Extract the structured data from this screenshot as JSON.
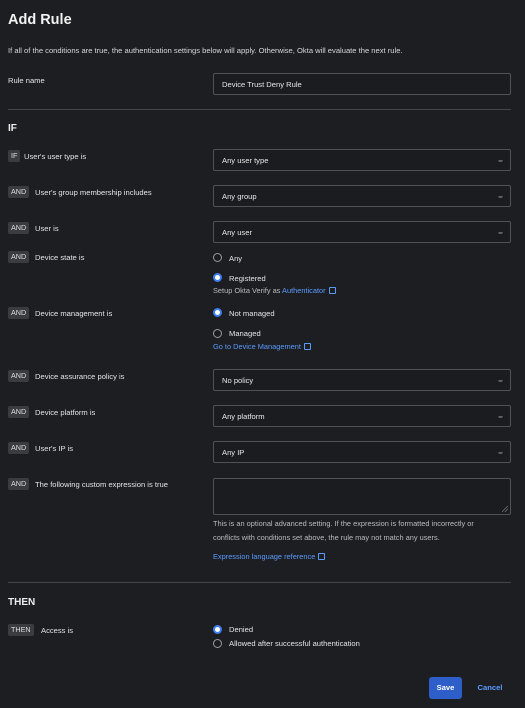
{
  "header": {
    "title": "Add Rule",
    "description": "If all of the conditions are true, the authentication settings below will apply. Otherwise, Okta will evaluate the next rule."
  },
  "rule_name": {
    "label": "Rule name",
    "value": "Device Trust Deny Rule"
  },
  "if_section": {
    "heading": "IF"
  },
  "conditions": {
    "user_type": {
      "tag": "IF",
      "label": "User's user type is",
      "value": "Any user type"
    },
    "group": {
      "tag": "AND",
      "label": "User's group membership includes",
      "value": "Any group"
    },
    "user": {
      "tag": "AND",
      "label": "User is",
      "value": "Any user"
    },
    "device_state": {
      "tag": "AND",
      "label": "Device state is",
      "options": [
        "Any",
        "Registered"
      ],
      "selected": "Registered",
      "helper_prefix": "Setup Okta Verify as",
      "helper_link": "Authenticator"
    },
    "device_management": {
      "tag": "AND",
      "label": "Device management is",
      "options": [
        "Not managed",
        "Managed"
      ],
      "selected": "Not managed",
      "link": "Go to Device Management"
    },
    "assurance": {
      "tag": "AND",
      "label": "Device assurance policy is",
      "value": "No policy"
    },
    "platform": {
      "tag": "AND",
      "label": "Device platform is",
      "value": "Any platform"
    },
    "ip": {
      "tag": "AND",
      "label": "User's IP is",
      "value": "Any IP"
    },
    "expression": {
      "tag": "AND",
      "label": "The following custom expression is true",
      "value": "",
      "help_line1": "This is an optional advanced setting. If the expression is formatted incorrectly or",
      "help_line2": "conflicts with conditions set above, the rule may not match any users.",
      "link": "Expression language reference"
    }
  },
  "then_section": {
    "heading": "THEN",
    "tag": "THEN",
    "label": "Access is",
    "options": [
      "Denied",
      "Allowed after successful authentication"
    ],
    "selected": "Denied"
  },
  "footer": {
    "save_label": "Save",
    "cancel_label": "Cancel"
  },
  "colors": {
    "background": "#1d1e21",
    "accent": "#2e5fc9",
    "link": "#5b9bff"
  }
}
